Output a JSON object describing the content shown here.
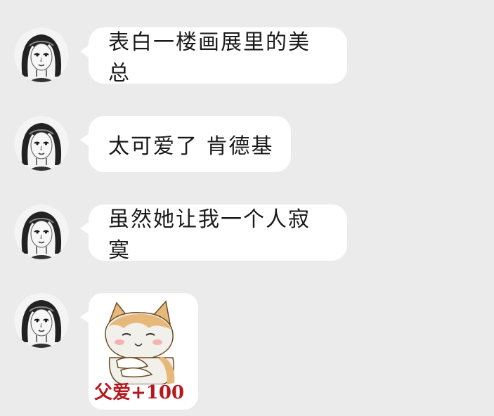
{
  "chat": {
    "messages": [
      {
        "sender_icon": "girl-avatar-icon",
        "text": "表白一楼画展里的美总"
      },
      {
        "sender_icon": "girl-avatar-icon",
        "text": "太可爱了 肯德基"
      },
      {
        "sender_icon": "girl-avatar-icon",
        "text": "虽然她让我一个人寂寞"
      },
      {
        "sender_icon": "girl-avatar-icon",
        "sticker": {
          "icon": "cat-hug-sticker-icon",
          "caption": "父爱+100"
        }
      }
    ]
  },
  "colors": {
    "background": "#ebebeb",
    "bubble": "#ffffff",
    "sticker_caption": "#b5171d",
    "cat_fur": "#e6b97a"
  }
}
